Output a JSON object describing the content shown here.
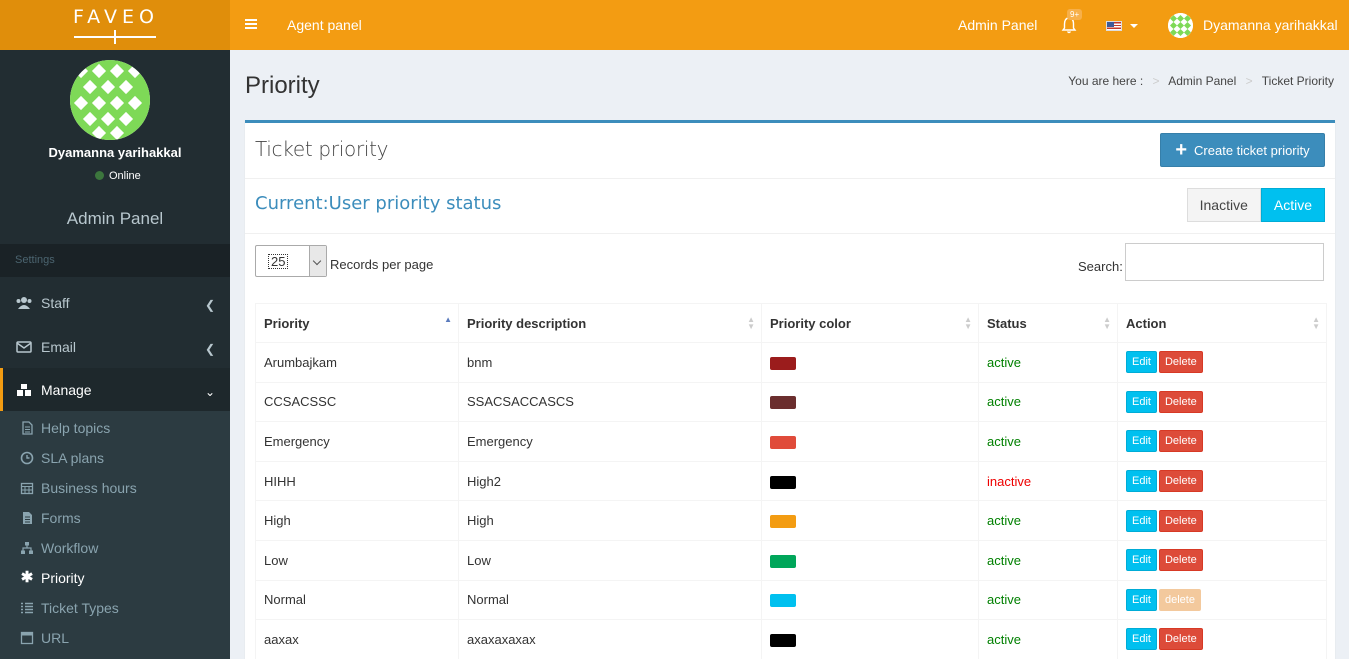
{
  "header": {
    "logo": "FAVEO",
    "agent_panel": "Agent panel",
    "admin_panel": "Admin Panel",
    "notification_badge": "9+",
    "user_name": "Dyamanna yarihakkal"
  },
  "sidebar": {
    "user_name": "Dyamanna yarihakkal",
    "status": "Online",
    "panel_title": "Admin Panel",
    "section_header": "Settings",
    "menu": [
      {
        "label": "Staff",
        "icon": "users-icon"
      },
      {
        "label": "Email",
        "icon": "envelope-icon"
      },
      {
        "label": "Manage",
        "icon": "cubes-icon"
      }
    ],
    "submenu": [
      {
        "label": "Help topics",
        "icon": "file-icon"
      },
      {
        "label": "SLA plans",
        "icon": "clock-icon"
      },
      {
        "label": "Business hours",
        "icon": "calendar-icon"
      },
      {
        "label": "Forms",
        "icon": "document-icon"
      },
      {
        "label": "Workflow",
        "icon": "sitemap-icon"
      },
      {
        "label": "Priority",
        "icon": "asterisk-icon"
      },
      {
        "label": "Ticket Types",
        "icon": "list-icon"
      },
      {
        "label": "URL",
        "icon": "server-icon"
      }
    ]
  },
  "page": {
    "title": "Priority",
    "breadcrumb": {
      "prefix": "You are here :",
      "items": [
        "Admin Panel",
        "Ticket Priority"
      ]
    }
  },
  "box": {
    "title": "Ticket priority",
    "create_button": "Create ticket priority",
    "status_title": "Current:User priority status",
    "toggle_inactive": "Inactive",
    "toggle_active": "Active",
    "per_page_value": "25",
    "per_page_label": "Records per page",
    "search_label": "Search:"
  },
  "table": {
    "headers": [
      "Priority",
      "Priority description",
      "Priority color",
      "Status",
      "Action"
    ],
    "rows": [
      {
        "priority": "Arumbajkam",
        "description": "bnm",
        "color": "#9b1c1c",
        "status": "active",
        "edit": "Edit",
        "delete": "Delete",
        "delete_disabled": false
      },
      {
        "priority": "CCSACSSC",
        "description": "SSACSACCASCS",
        "color": "#6b2e2e",
        "status": "active",
        "edit": "Edit",
        "delete": "Delete",
        "delete_disabled": false
      },
      {
        "priority": "Emergency",
        "description": "Emergency",
        "color": "#e04b3a",
        "status": "active",
        "edit": "Edit",
        "delete": "Delete",
        "delete_disabled": false
      },
      {
        "priority": "HIHH",
        "description": "High2",
        "color": "#000000",
        "status": "inactive",
        "edit": "Edit",
        "delete": "Delete",
        "delete_disabled": false
      },
      {
        "priority": "High",
        "description": "High",
        "color": "#f39c12",
        "status": "active",
        "edit": "Edit",
        "delete": "Delete",
        "delete_disabled": false
      },
      {
        "priority": "Low",
        "description": "Low",
        "color": "#00a65a",
        "status": "active",
        "edit": "Edit",
        "delete": "Delete",
        "delete_disabled": false
      },
      {
        "priority": "Normal",
        "description": "Normal",
        "color": "#00c0ef",
        "status": "active",
        "edit": "Edit",
        "delete": "delete",
        "delete_disabled": true
      },
      {
        "priority": "aaxax",
        "description": "axaxaxaxax",
        "color": "#000000",
        "status": "active",
        "edit": "Edit",
        "delete": "Delete",
        "delete_disabled": false
      }
    ]
  },
  "colors": {
    "header_bg": "#f39c12",
    "logo_bg": "#e08e0b",
    "sidebar_bg": "#222d32",
    "primary": "#3c8dbc",
    "info": "#00c0ef",
    "danger": "#dd4b39"
  }
}
